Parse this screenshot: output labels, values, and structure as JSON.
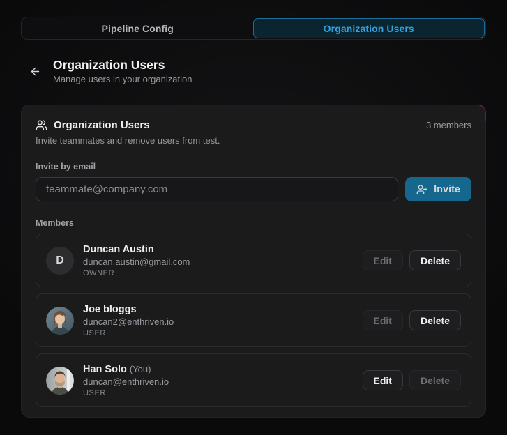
{
  "tabs": [
    {
      "label": "Pipeline Config",
      "active": false
    },
    {
      "label": "Organization Users",
      "active": true
    }
  ],
  "header": {
    "title": "Organization Users",
    "subtitle": "Manage users in your organization"
  },
  "card": {
    "title": "Organization Users",
    "members_count": "3 members",
    "description": "Invite teammates and remove users from test.",
    "invite_label": "Invite by email",
    "invite_placeholder": "teammate@company.com",
    "invite_button_label": "Invite",
    "members_label": "Members",
    "actions": {
      "edit_label": "Edit",
      "delete_label": "Delete"
    },
    "members": [
      {
        "name": "Duncan Austin",
        "suffix": "",
        "email": "duncan.austin@gmail.com",
        "role": "OWNER",
        "avatar_letter": "D",
        "avatar_type": "letter"
      },
      {
        "name": "Joe bloggs",
        "suffix": "",
        "email": "duncan2@enthriven.io",
        "role": "USER",
        "avatar_type": "photo-woman"
      },
      {
        "name": "Han Solo",
        "suffix": "(You)",
        "email": "duncan@enthriven.io",
        "role": "USER",
        "avatar_type": "photo-man"
      }
    ]
  },
  "icons": {
    "back": "arrow-left-icon",
    "card_header": "users-icon",
    "invite": "user-plus-icon"
  },
  "colors": {
    "page_bg": "#0a0a0b",
    "card_bg": "#1b1b1c",
    "accent_blue": "#30a1da",
    "active_tab_bg": "#0a2430",
    "active_tab_border": "#1d6d99",
    "invite_button_bg": "#15678e",
    "muted_text": "#989a9e"
  }
}
